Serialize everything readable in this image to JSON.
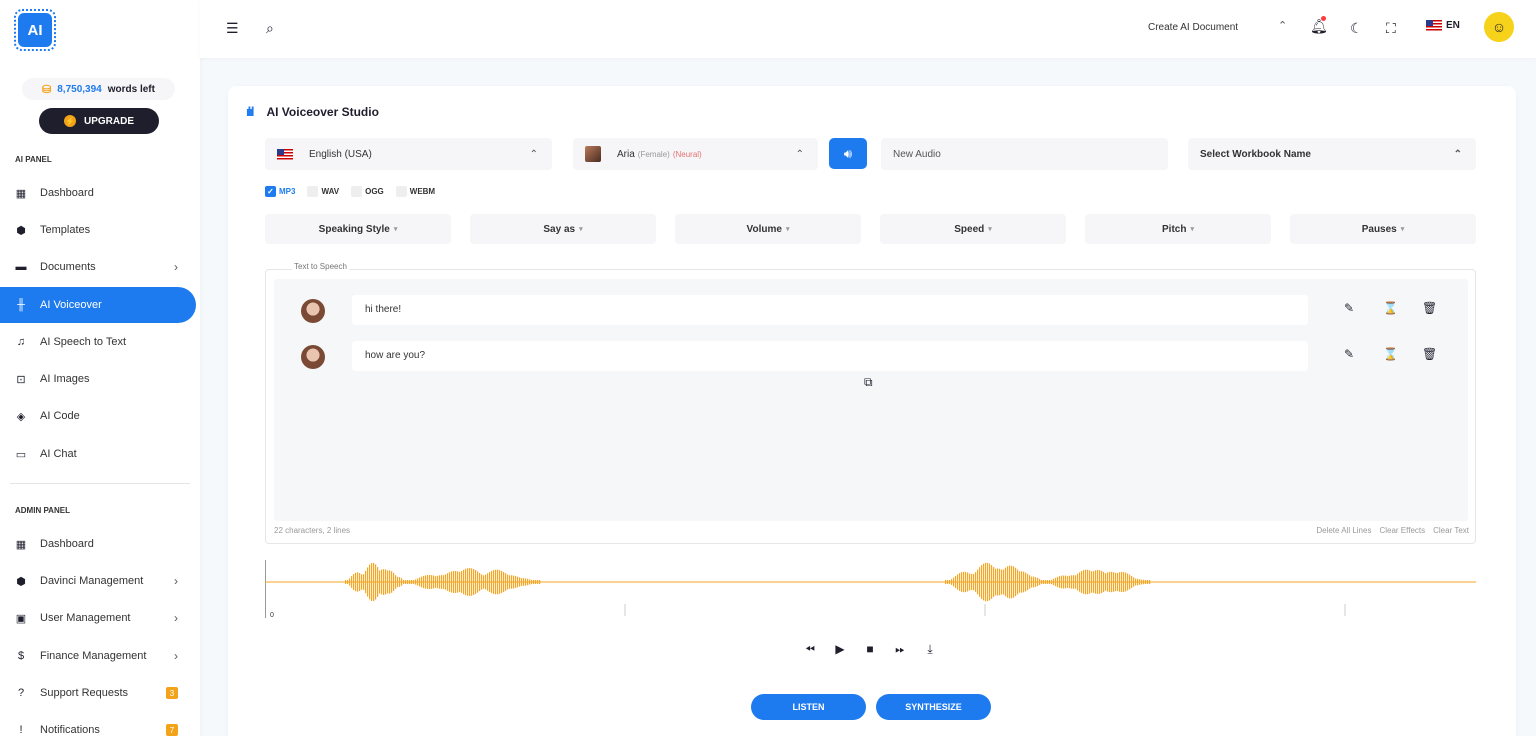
{
  "sidebar": {
    "logo_text": "AI",
    "words_count": "8,750,394",
    "words_suffix": "words left",
    "upgrade_label": "UPGRADE",
    "ai_panel_label": "AI PANEL",
    "admin_panel_label": "ADMIN PANEL",
    "ai_items": [
      {
        "label": "Dashboard",
        "icon": "dashboard-icon"
      },
      {
        "label": "Templates",
        "icon": "ai-chip-icon"
      },
      {
        "label": "Documents",
        "icon": "folder-icon"
      },
      {
        "label": "AI Voiceover",
        "icon": "waveform-icon"
      },
      {
        "label": "AI Speech to Text",
        "icon": "music-file-icon"
      },
      {
        "label": "AI Images",
        "icon": "image-scan-icon"
      },
      {
        "label": "AI Code",
        "icon": "code-icon"
      },
      {
        "label": "AI Chat",
        "icon": "chat-icon"
      }
    ],
    "admin_items": [
      {
        "label": "Dashboard",
        "icon": "dashboard-icon"
      },
      {
        "label": "Davinci Management",
        "icon": "ai-chip-icon"
      },
      {
        "label": "User Management",
        "icon": "user-badge-icon"
      },
      {
        "label": "Finance Management",
        "icon": "money-bag-icon"
      },
      {
        "label": "Support Requests",
        "icon": "help-icon",
        "badge": "3"
      },
      {
        "label": "Notifications",
        "icon": "alert-icon",
        "badge": "7"
      }
    ]
  },
  "header": {
    "create_label": "Create AI Document",
    "language": "EN"
  },
  "studio": {
    "title": "AI Voiceover Studio",
    "language": "English (USA)",
    "voice_name": "Aria",
    "voice_gender": "(Female)",
    "voice_type": "(Neural)",
    "audio_placeholder": "New Audio",
    "workbook_label": "Select Workbook Name",
    "formats": [
      {
        "label": "MP3",
        "checked": true
      },
      {
        "label": "WAV",
        "checked": false
      },
      {
        "label": "OGG",
        "checked": false
      },
      {
        "label": "WEBM",
        "checked": false
      }
    ],
    "effects": [
      "Speaking Style",
      "Say as",
      "Volume",
      "Speed",
      "Pitch",
      "Pauses"
    ],
    "tts_label": "Text to Speech",
    "lines": [
      "hi there!",
      "how are you?"
    ],
    "stats": "22 characters, 2 lines",
    "delete_all": "Delete All Lines",
    "clear_effects": "Clear Effects",
    "clear_text": "Clear Text",
    "wave_zero": "0",
    "listen_label": "LISTEN",
    "synthesize_label": "SYNTHESIZE"
  },
  "colors": {
    "accent": "#1e7bef",
    "wave": "#f5a623",
    "dark": "#1e1e2d"
  }
}
